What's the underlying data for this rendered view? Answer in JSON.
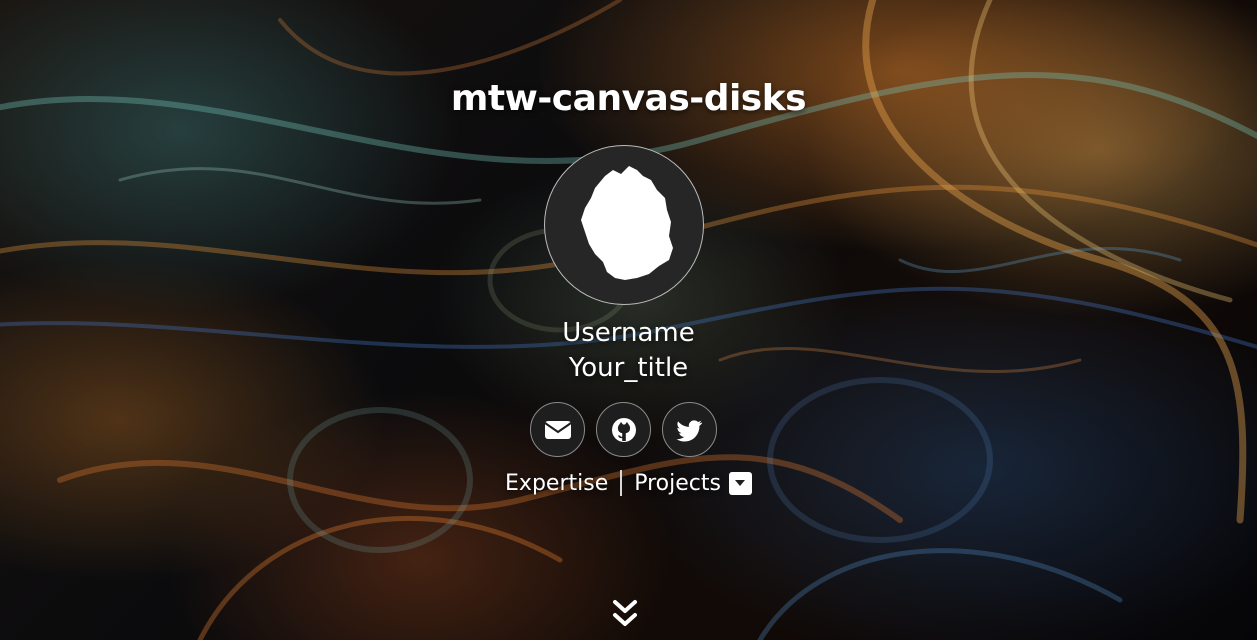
{
  "header": {
    "title": "mtw-canvas-disks"
  },
  "profile": {
    "avatar_icon": "silhouette-map-icon",
    "username": "Username",
    "title": "Your_title"
  },
  "socials": [
    {
      "name": "email",
      "icon": "envelope-icon"
    },
    {
      "name": "github",
      "icon": "github-icon"
    },
    {
      "name": "twitter",
      "icon": "twitter-icon"
    }
  ],
  "nav": {
    "expertise_label": "Expertise",
    "projects_label": "Projects",
    "projects_dropdown_icon": "caret-down-icon"
  },
  "scroll": {
    "icon": "double-chevron-down-icon"
  },
  "colors": {
    "text": "#ffffff",
    "button_bg": "#1e1e1e",
    "avatar_bg": "#262626"
  }
}
